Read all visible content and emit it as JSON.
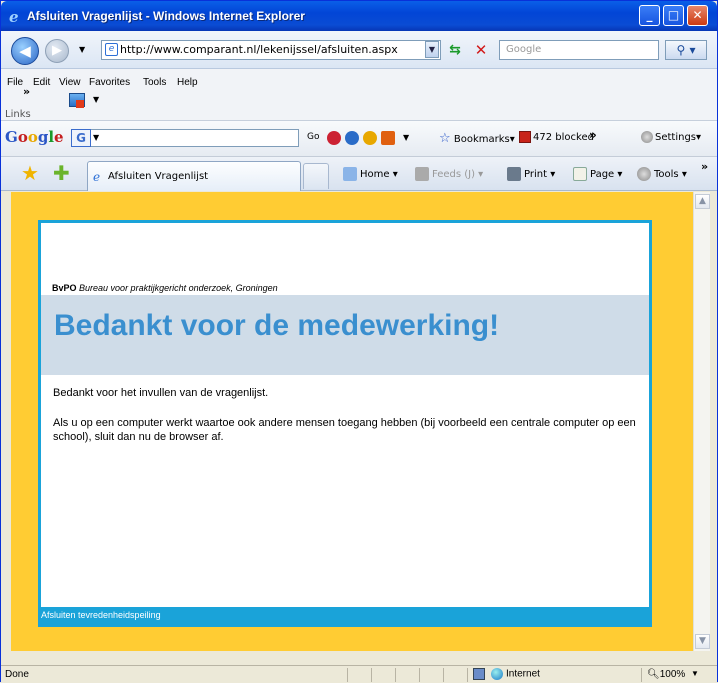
{
  "window": {
    "title": "Afsluiten Vragenlijst - Windows Internet Explorer",
    "min_label": "_",
    "max_label": "□",
    "close_label": "✕"
  },
  "address": {
    "url": "http://www.comparant.nl/lekenijssel/afsluiten.aspx",
    "search_placeholder": "Google"
  },
  "menu": {
    "items": [
      "File",
      "Edit",
      "View",
      "Favorites",
      "Tools",
      "Help"
    ],
    "links_label": "Links",
    "chevron": "»"
  },
  "google_toolbar": {
    "logo": "Google",
    "go_label": "Go",
    "bookmarks_label": "Bookmarks▾",
    "blocked_label": "472 blocked",
    "chevron": "»",
    "settings_label": "Settings▾"
  },
  "tabs": {
    "active_title": "Afsluiten Vragenlijst",
    "home_label": "Home",
    "feeds_label": "Feeds (J)",
    "print_label": "Print",
    "page_label": "Page",
    "tools_label": "Tools",
    "chevron": "»"
  },
  "page": {
    "org_name": "BvPO",
    "org_desc": "Bureau voor praktijkgericht onderzoek, Groningen",
    "heading": "Bedankt voor de medewerking!",
    "paragraph1": "Bedankt voor het invullen van de vragenlijst.",
    "paragraph2": "Als u op een computer werkt waartoe ook andere mensen toegang hebben (bij voorbeeld een centrale computer op een school), sluit dan nu de browser af.",
    "footer": "Afsluiten tevredenheidspeiling"
  },
  "status": {
    "text": "Done",
    "zone": "Internet",
    "zoom": "100%"
  },
  "colors": {
    "page_background": "#ffcc33",
    "panel_border": "#1aa3d9",
    "heading_band": "#cfdce8",
    "heading_text": "#3a8fcf"
  }
}
